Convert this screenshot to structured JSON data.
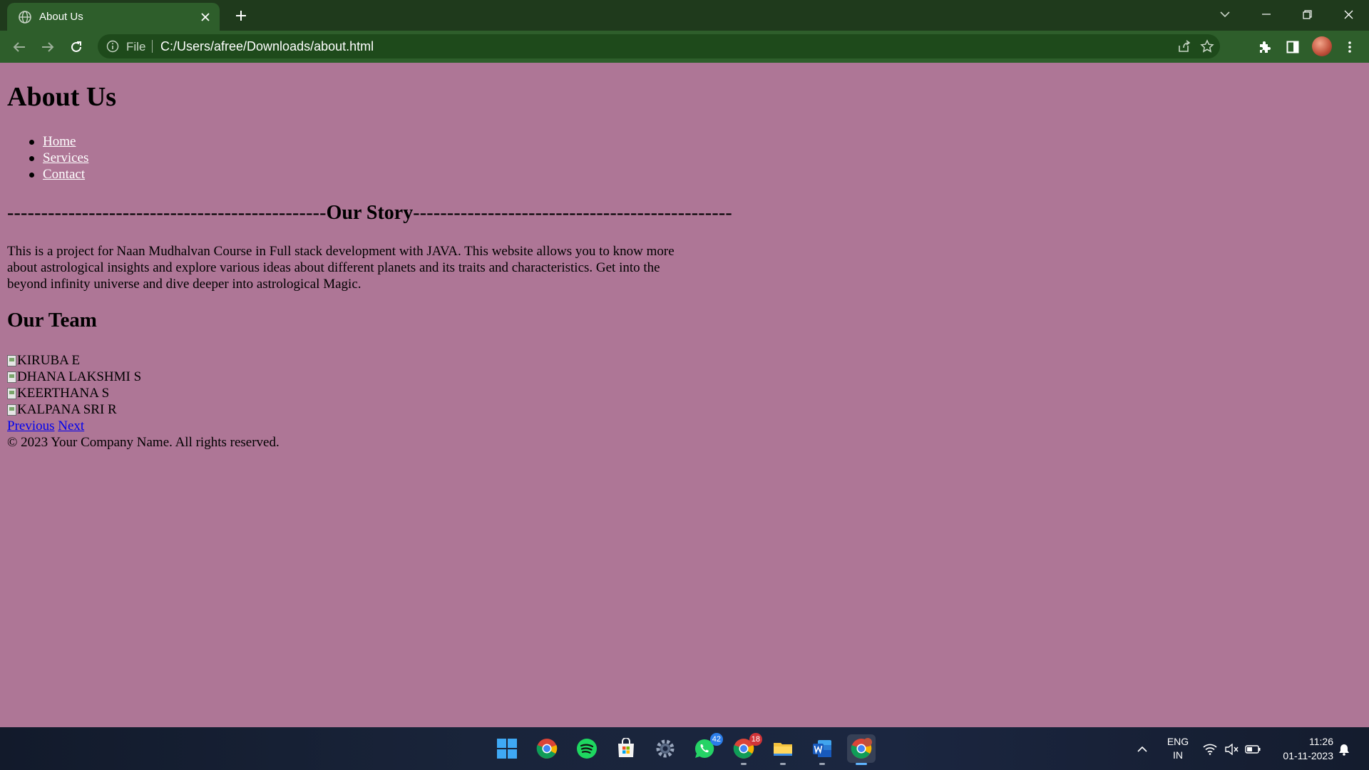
{
  "browser": {
    "tab_title": "About Us",
    "address_scheme": "File",
    "address_url": "C:/Users/afree/Downloads/about.html"
  },
  "page": {
    "title": "About Us",
    "nav": [
      {
        "label": "Home"
      },
      {
        "label": "Services"
      },
      {
        "label": "Contact"
      }
    ],
    "story_dashes_left": "-----------------------------------------------",
    "story_heading": "Our Story",
    "story_dashes_right": "-----------------------------------------------",
    "story_text": "This is a project for Naan Mudhalvan Course in Full stack development with JAVA. This website allows you to know more about astrological insights and explore various ideas about different planets and its traits and characteristics. Get into the beyond infinity universe and dive deeper into astrological Magic.",
    "team_heading": "Our Team",
    "team": [
      {
        "name": "KIRUBA E"
      },
      {
        "name": "DHANA LAKSHMI S"
      },
      {
        "name": "KEERTHANA S"
      },
      {
        "name": "KALPANA SRI R"
      }
    ],
    "pager_previous": "Previous",
    "pager_next": "Next",
    "footer": "© 2023 Your Company Name. All rights reserved."
  },
  "taskbar": {
    "apps": [
      {
        "icon": "windows-start-icon"
      },
      {
        "icon": "chrome-icon"
      },
      {
        "icon": "spotify-icon"
      },
      {
        "icon": "microsoft-store-icon"
      },
      {
        "icon": "settings-icon"
      },
      {
        "icon": "whatsapp-icon",
        "badge": "42"
      },
      {
        "icon": "chrome-profile-icon",
        "badge": "18"
      },
      {
        "icon": "file-explorer-icon"
      },
      {
        "icon": "word-icon"
      },
      {
        "icon": "chrome-active-icon"
      }
    ],
    "language_top": "ENG",
    "language_bottom": "IN",
    "time": "11:26",
    "date": "01-11-2023"
  },
  "colors": {
    "page_background": "#ae7696",
    "chrome_dark": "#1f3a1c",
    "chrome_light": "#2e5e2b",
    "taskbar": "#19243a"
  }
}
